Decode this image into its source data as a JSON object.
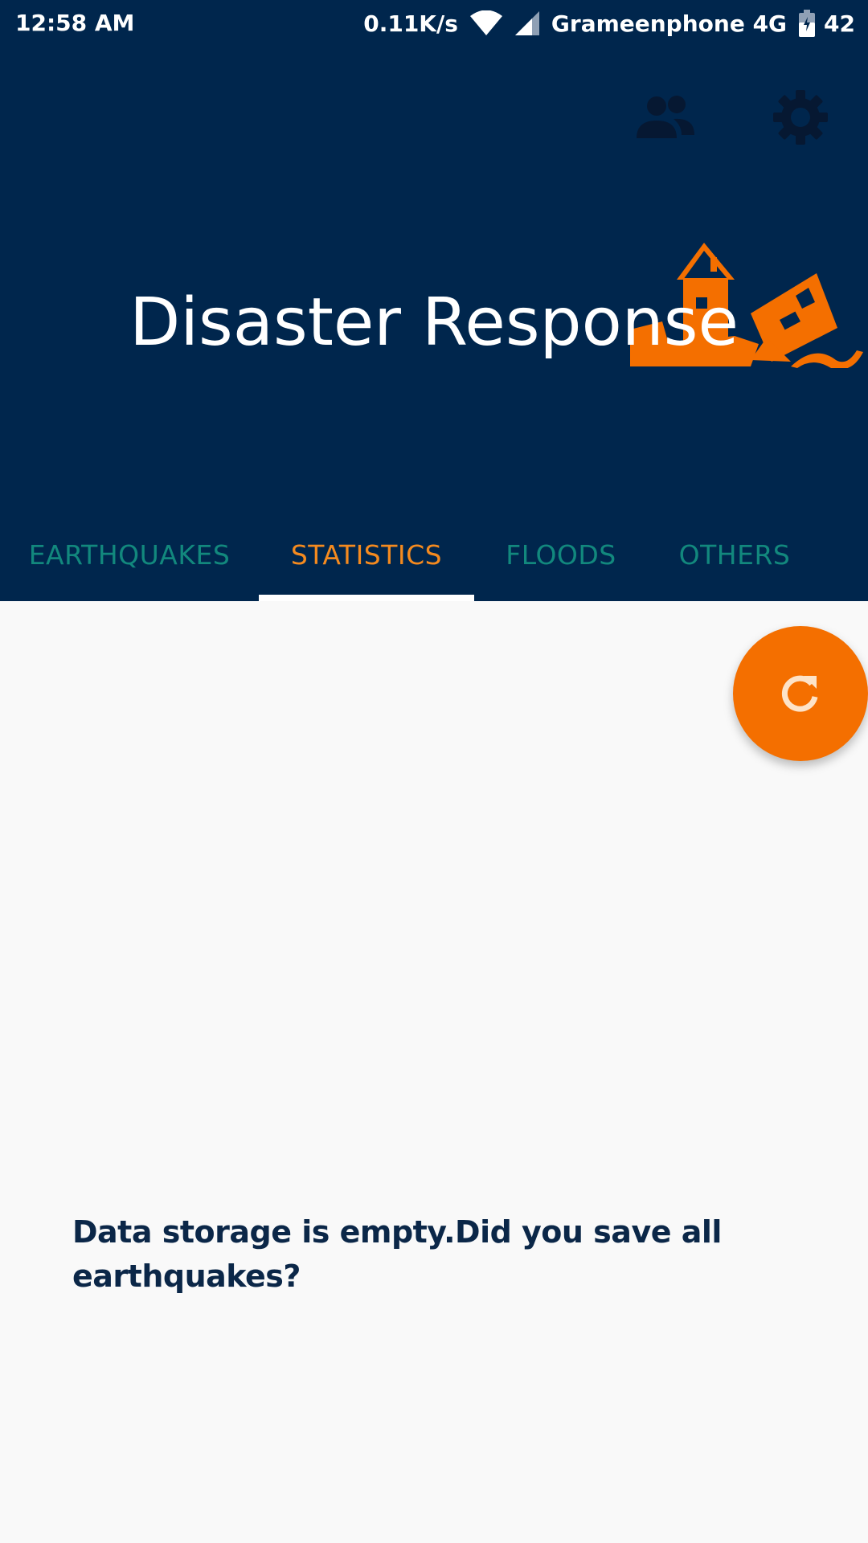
{
  "status_bar": {
    "time": "12:58 AM",
    "net_speed": "0.11K/s",
    "carrier": "Grameenphone 4G",
    "battery": "42",
    "icons": [
      "wifi-icon",
      "cell-signal-icon",
      "battery-charging-icon"
    ]
  },
  "toolbar": {
    "actions": [
      {
        "name": "people-icon"
      },
      {
        "name": "settings-icon"
      }
    ]
  },
  "header": {
    "title": "Disaster Response",
    "illustration": "disaster-house-icon"
  },
  "tabs": [
    {
      "label": "EARTHQUAKES",
      "active": false
    },
    {
      "label": "STATISTICS",
      "active": true
    },
    {
      "label": "FLOODS",
      "active": false
    },
    {
      "label": "OTHERS",
      "active": false
    }
  ],
  "fab": {
    "icon": "refresh-icon"
  },
  "content": {
    "empty_message": "Data storage is empty.Did you save all earthquakes?"
  },
  "colors": {
    "app_bar": "#00264d",
    "tab_inactive": "#12887d",
    "tab_active": "#f48a1f",
    "accent": "#f46f00",
    "background": "#f9f9f9",
    "message_text": "#0b2748"
  }
}
